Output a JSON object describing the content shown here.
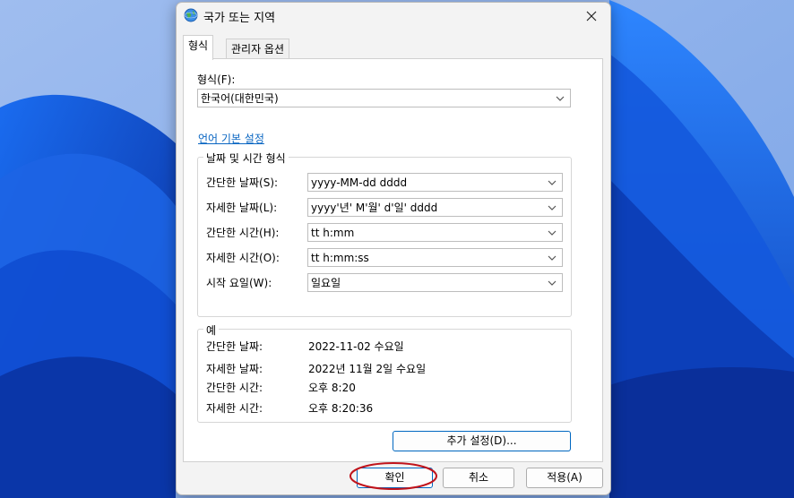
{
  "window": {
    "title": "국가 또는 지역",
    "close_icon": "close-icon",
    "app_icon": "globe-icon"
  },
  "tabs": [
    {
      "label": "형식",
      "active": true
    },
    {
      "label": "관리자 옵션",
      "active": false
    }
  ],
  "format": {
    "label": "형식(F):",
    "value": "한국어(대한민국)"
  },
  "language_link": "언어 기본 설정",
  "datetime_group": {
    "title": "날짜 및 시간 형식",
    "rows": [
      {
        "label": "간단한 날짜(S):",
        "value": "yyyy-MM-dd dddd"
      },
      {
        "label": "자세한 날짜(L):",
        "value": "yyyy'년' M'월' d'일' dddd"
      },
      {
        "label": "간단한 시간(H):",
        "value": "tt h:mm"
      },
      {
        "label": "자세한 시간(O):",
        "value": "tt h:mm:ss"
      },
      {
        "label": "시작 요일(W):",
        "value": "일요일"
      }
    ]
  },
  "example_group": {
    "title": "예",
    "rows": [
      {
        "label": "간단한 날짜:",
        "value": "2022-11-02 수요일"
      },
      {
        "label": "자세한 날짜:",
        "value": "2022년 11월 2일 수요일"
      },
      {
        "label": "간단한 시간:",
        "value": "오후 8:20"
      },
      {
        "label": "자세한 시간:",
        "value": "오후 8:20:36"
      }
    ]
  },
  "buttons": {
    "additional_settings": "추가 설정(D)...",
    "ok": "확인",
    "cancel": "취소",
    "apply": "적용(A)"
  },
  "colors": {
    "link": "#0a66c2",
    "accent": "#0067c0",
    "annotation": "#c0131b"
  }
}
